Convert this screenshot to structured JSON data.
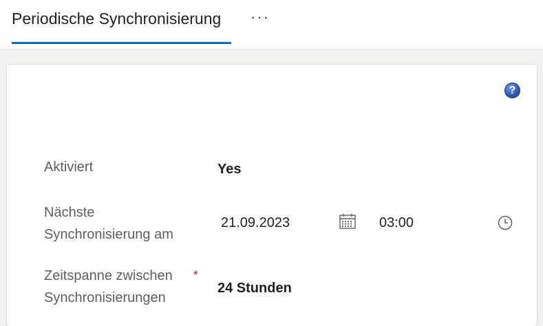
{
  "header": {
    "tab_label": "Periodische Synchronisierung",
    "more_label": "···"
  },
  "help": {
    "label": "?"
  },
  "form": {
    "enabled": {
      "label": "Aktiviert",
      "value": "Yes"
    },
    "next_sync": {
      "label_line1": "Nächste",
      "label_line2": "Synchronisierung am",
      "date": "21.09.2023",
      "time": "03:00",
      "date_icon": "calendar-icon",
      "time_icon": "clock-icon"
    },
    "interval": {
      "label_line1": "Zeitspanne zwischen",
      "label_line2": "Synchronisierungen",
      "required_marker": "*",
      "value": "24 Stunden"
    }
  },
  "colors": {
    "accent": "#0f6cbd",
    "required": "#c50f1f"
  }
}
